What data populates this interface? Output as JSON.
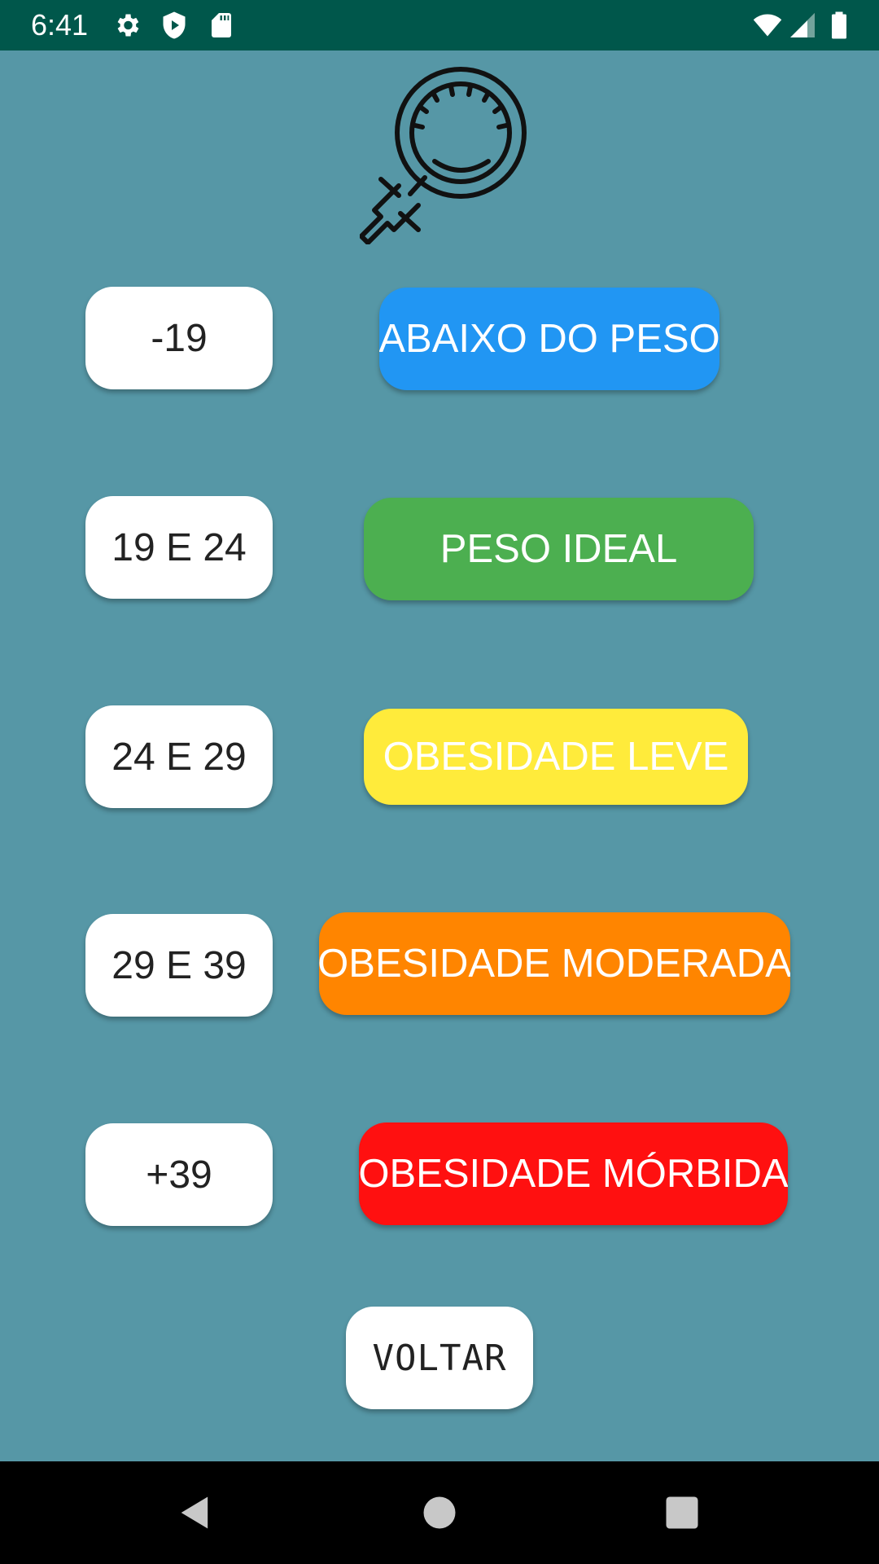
{
  "status_bar": {
    "time": "6:41",
    "left_icons": [
      "gear-icon",
      "shield-play-icon",
      "sd-card-icon"
    ],
    "right_icons": [
      "wifi-icon",
      "signal-icon",
      "battery-icon"
    ]
  },
  "header": {
    "logo_icon": "female-symbol-scale-icon"
  },
  "rows": [
    {
      "range": "-19",
      "category": "ABAIXO DO PESO",
      "color": "#2196f3"
    },
    {
      "range": "19 E 24",
      "category": "PESO IDEAL",
      "color": "#4caf50"
    },
    {
      "range": "24 E 29",
      "category": "OBESIDADE LEVE",
      "color": "#ffeb3b"
    },
    {
      "range": "29 E 39",
      "category": "OBESIDADE MODERADA",
      "color": "#ff8500"
    },
    {
      "range": "+39",
      "category": "OBESIDADE MÓRBIDA",
      "color": "#ff1010"
    }
  ],
  "voltar_label": "VOLTAR",
  "nav_bar": {
    "icons": [
      "back-icon",
      "home-icon",
      "recents-icon"
    ]
  },
  "colors": {
    "background": "#5697a6",
    "status_bar": "#00574b",
    "nav_bar": "#000000"
  }
}
